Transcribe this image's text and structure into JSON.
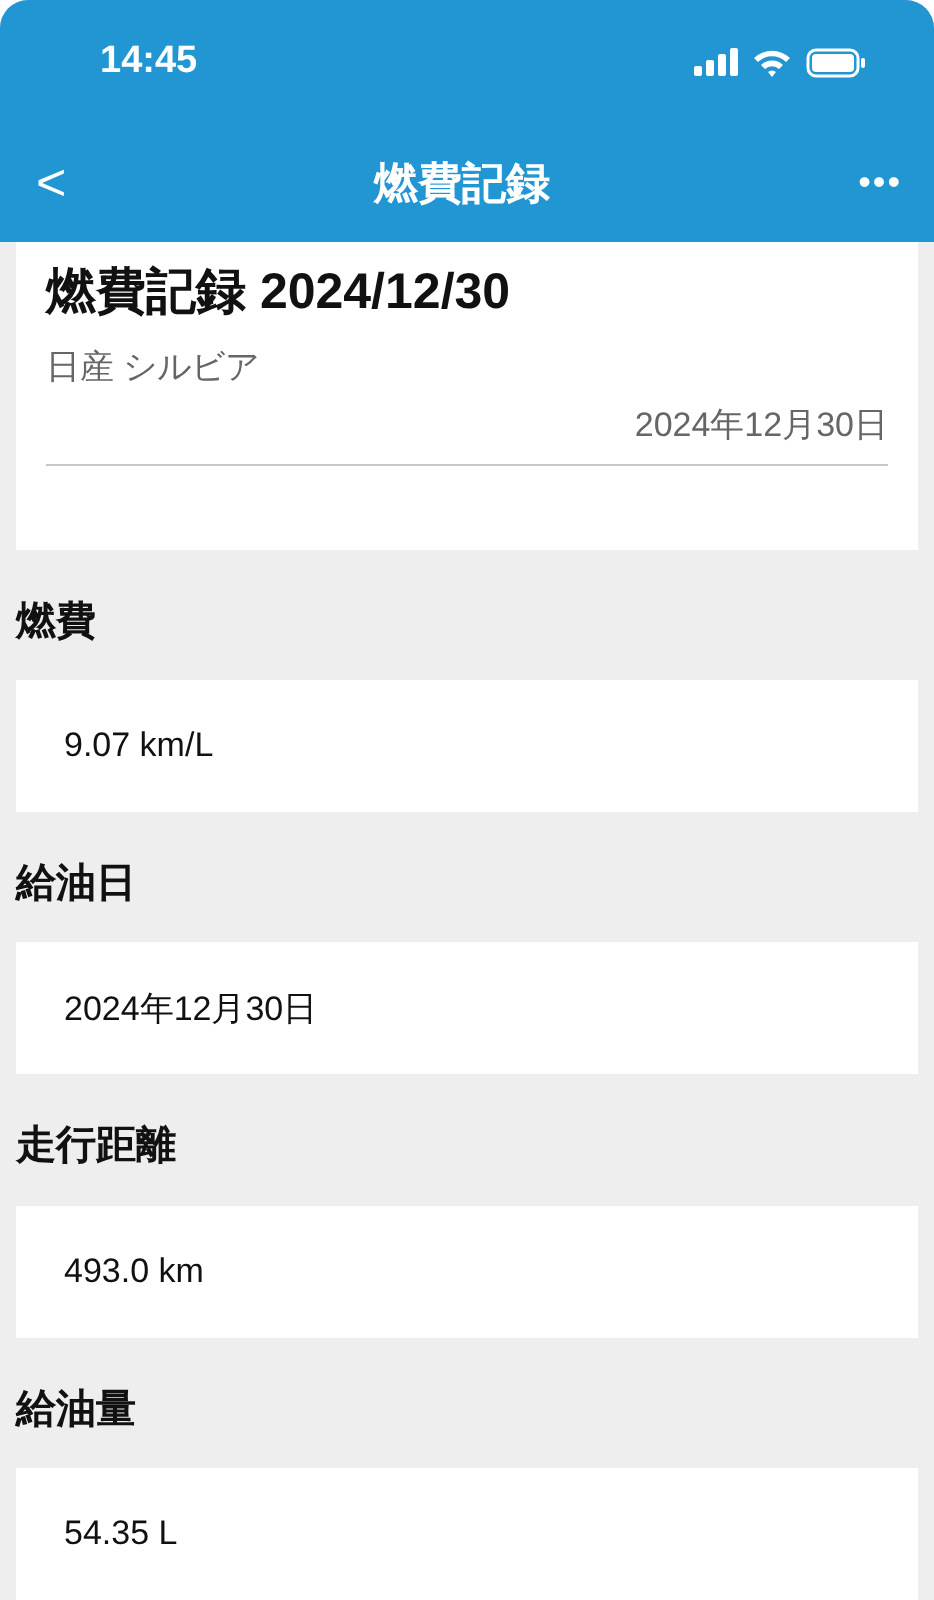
{
  "status_bar": {
    "time": "14:45"
  },
  "nav_bar": {
    "back": "<",
    "title": "燃費記録",
    "more": "•••"
  },
  "header": {
    "title": "燃費記録 2024/12/30",
    "subtitle": "日産 シルビア",
    "date": "2024年12月30日"
  },
  "fields": [
    {
      "label": "燃費",
      "value": "9.07 km/L"
    },
    {
      "label": "給油日",
      "value": "2024年12月30日"
    },
    {
      "label": "走行距離",
      "value": "493.0 km"
    },
    {
      "label": "給油量",
      "value": "54.35 L"
    }
  ]
}
